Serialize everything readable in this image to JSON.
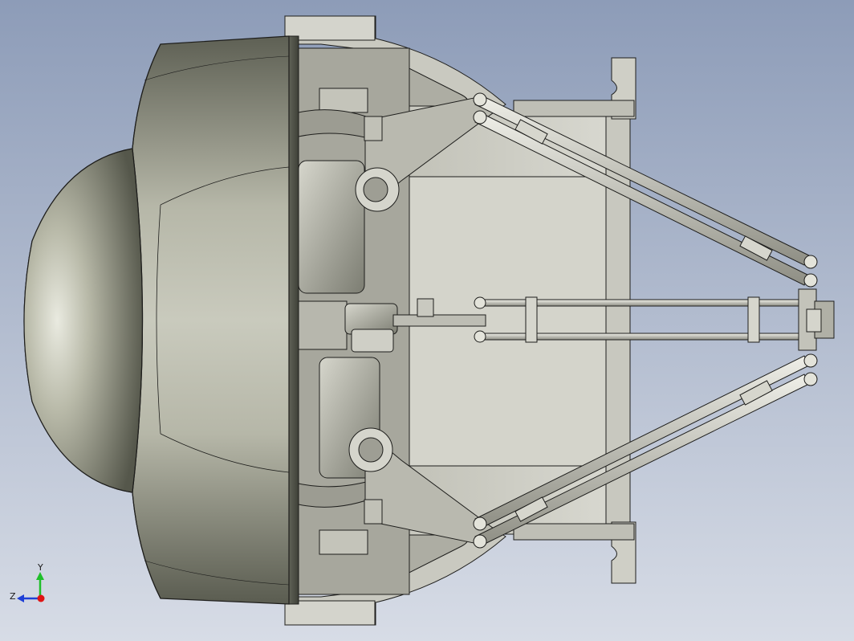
{
  "viewport": {
    "background_top": "#8d9cb8",
    "background_bottom": "#d7dce6"
  },
  "model": {
    "shell_color": "#8a8b7c",
    "shell_highlight": "#e9eae0",
    "frame_color": "#c7c7bd",
    "rod_color": "#bdbdb3",
    "edge_color": "#1e1e1c"
  },
  "triad": {
    "y_label": "Y",
    "z_label": "Z",
    "y_axis_color": "#1fbf2a",
    "z_axis_color": "#1e3fd6",
    "x_axis_color": "#e01414"
  }
}
